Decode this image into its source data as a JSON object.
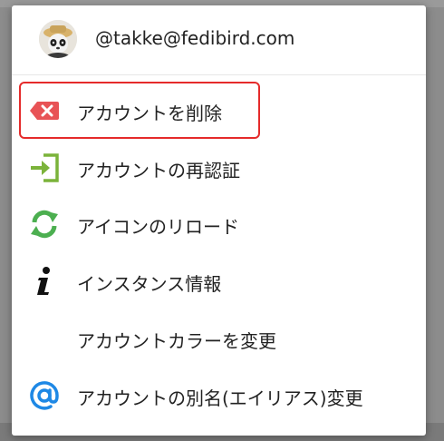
{
  "header": {
    "account": "@takke@fedibird.com"
  },
  "menu": {
    "items": [
      {
        "label": "アカウントを削除",
        "icon": "delete-account-icon"
      },
      {
        "label": "アカウントの再認証",
        "icon": "login-icon"
      },
      {
        "label": "アイコンのリロード",
        "icon": "reload-icon"
      },
      {
        "label": "インスタンス情報",
        "icon": "info-icon"
      },
      {
        "label": "アカウントカラーを変更",
        "icon": ""
      },
      {
        "label": "アカウントの別名(エイリアス)変更",
        "icon": "at-sign-icon"
      }
    ]
  },
  "colors": {
    "delete": "#e85356",
    "login": "#7bb33a",
    "reload": "#4caf50",
    "at": "#1e88e5",
    "highlight": "#e52b2b"
  }
}
